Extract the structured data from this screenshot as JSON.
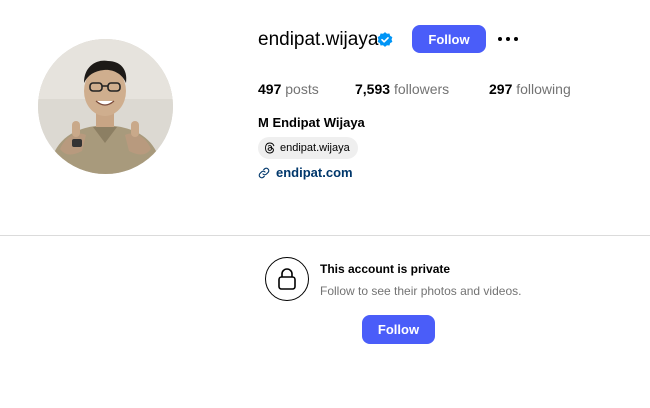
{
  "profile": {
    "username": "endipat.wijaya",
    "verified": true,
    "follow_label": "Follow",
    "more_icon": "more-horizontal-icon",
    "full_name": "M Endipat Wijaya",
    "threads_handle": "endipat.wijaya",
    "link_text": "endipat.com"
  },
  "stats": {
    "posts_count": "497",
    "posts_label": "posts",
    "followers_count": "7,593",
    "followers_label": "followers",
    "following_count": "297",
    "following_label": "following"
  },
  "private_notice": {
    "title": "This account is private",
    "subtitle": "Follow to see their photos and videos.",
    "follow_label": "Follow"
  },
  "colors": {
    "accent": "#4a5df9",
    "verified_badge": "#0095f6",
    "link": "#00376b",
    "secondary_text": "#737373"
  }
}
